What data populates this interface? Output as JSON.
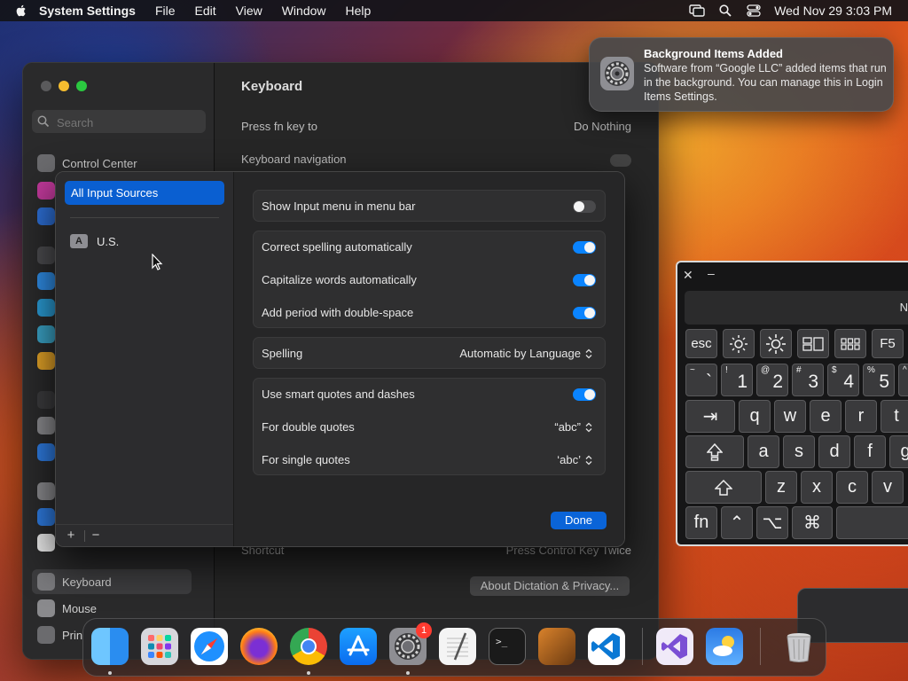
{
  "menubar": {
    "app_name": "System Settings",
    "menus": [
      "File",
      "Edit",
      "View",
      "Window",
      "Help"
    ],
    "clock": "Wed Nov 29  3:03 PM"
  },
  "settings": {
    "search_placeholder": "Search",
    "sidebar": {
      "control_center": "Control Center",
      "keyboard": "Keyboard",
      "mouse": "Mouse",
      "printers": "Prin"
    },
    "content": {
      "title": "Keyboard",
      "press_fn_label": "Press fn key to",
      "press_fn_value": "Do Nothing",
      "keyboard_nav_label": "Keyboard navigation",
      "shortcut_label": "Shortcut",
      "shortcut_value": "Press Control Key Twice",
      "dictation_button": "About Dictation & Privacy..."
    }
  },
  "sheet": {
    "sources": {
      "all": "All Input Sources",
      "us_badge": "A",
      "us": "U.S.",
      "add": "+",
      "remove": "−"
    },
    "options": {
      "show_input_menu": {
        "label": "Show Input menu in menu bar",
        "on": false
      },
      "correct_spelling": {
        "label": "Correct spelling automatically",
        "on": true
      },
      "capitalize_words": {
        "label": "Capitalize words automatically",
        "on": true
      },
      "add_period": {
        "label": "Add period with double-space",
        "on": true
      },
      "spelling": {
        "label": "Spelling",
        "value": "Automatic by Language"
      },
      "smart_quotes": {
        "label": "Use smart quotes and dashes",
        "on": true
      },
      "double_quotes": {
        "label": "For double quotes",
        "value": "“abc”"
      },
      "single_quotes": {
        "label": "For single quotes",
        "value": "‘abc’"
      }
    },
    "done": "Done"
  },
  "notification": {
    "title": "Background Items Added",
    "body": "Software from “Google LLC” added items that run in the background. You can manage this in Login Items Settings."
  },
  "keyboard_viewer": {
    "close": "✕",
    "minimize": "–",
    "partial_text": "N",
    "row1": [
      "esc",
      "F5"
    ],
    "row2": [
      {
        "sub": "~",
        "main": "`"
      },
      {
        "sub": "!",
        "main": "1"
      },
      {
        "sub": "@",
        "main": "2"
      },
      {
        "sub": "#",
        "main": "3"
      },
      {
        "sub": "$",
        "main": "4"
      },
      {
        "sub": "%",
        "main": "5"
      },
      {
        "sub": "^",
        "main": ""
      }
    ],
    "row3": [
      "⇥",
      "q",
      "w",
      "e",
      "r",
      "t"
    ],
    "row4": [
      "a",
      "s",
      "d",
      "f",
      "g"
    ],
    "row5": [
      "z",
      "x",
      "c",
      "v"
    ],
    "row6": [
      "fn",
      "⌃",
      "⌥",
      "⌘"
    ]
  },
  "dock": {
    "badge": "1"
  }
}
